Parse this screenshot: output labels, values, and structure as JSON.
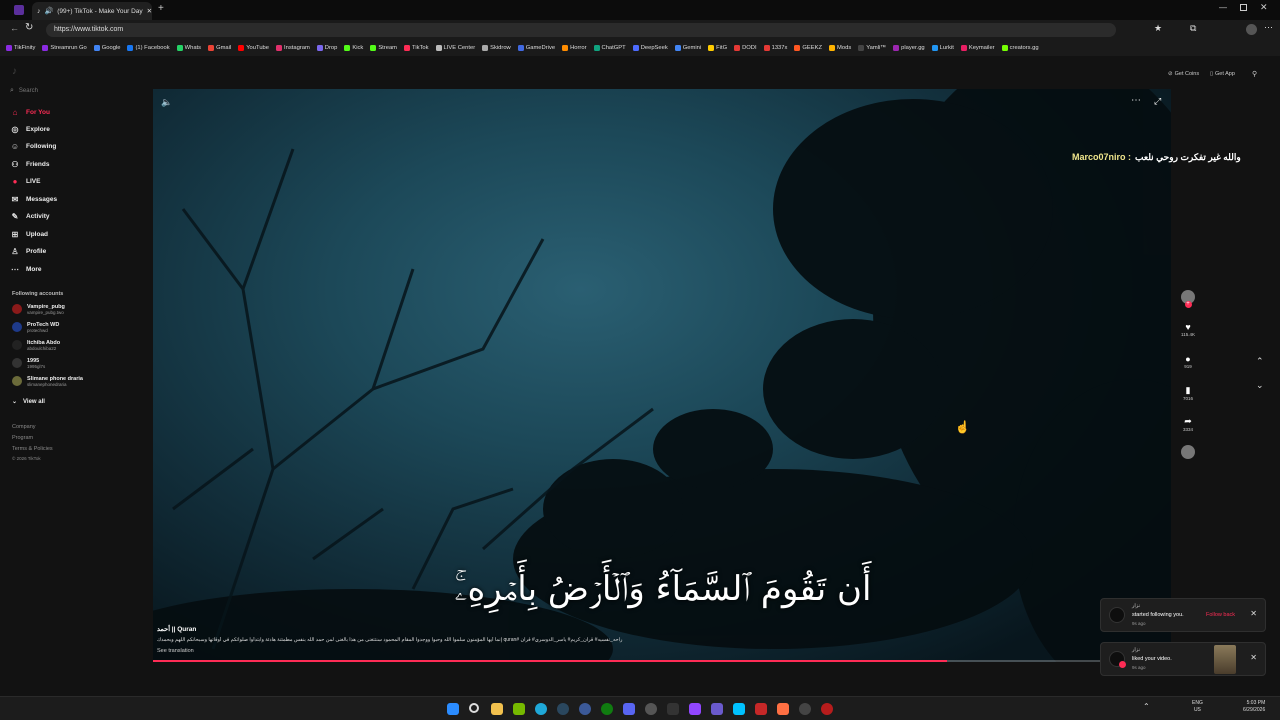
{
  "browser": {
    "tab_title": "(99+) TikTok - Make Your Day",
    "url": "https://www.tiktok.com",
    "bookmarks": [
      "TikFinity",
      "Streamrun Go",
      "Google",
      "(1) Facebook",
      "Whats",
      "Gmail",
      "YouTube",
      "Instagram",
      "Drop",
      "Kick",
      "Stream",
      "TikTok",
      "LIVE Center",
      "Skidrow",
      "GameDrive",
      "Horror",
      "ChatGPT",
      "DeepSeek",
      "Gemini",
      "FitG",
      "DODI",
      "1337x",
      "GEEKZ",
      "Mods",
      "Yamli™",
      "player.gg",
      "Lurkit",
      "Keymailer",
      "creators.gg"
    ],
    "bookmark_colors": [
      "#8a2be2",
      "#8a2be2",
      "#4285f4",
      "#1877f2",
      "#25d366",
      "#ea4335",
      "#ff0000",
      "#e1306c",
      "#7b68ee",
      "#53fc18",
      "#53fc18",
      "#fe2c55",
      "#bbbbbb",
      "#aaaaaa",
      "#4169e1",
      "#ff8c00",
      "#10a37f",
      "#4d6bfe",
      "#4285f4",
      "#ffcc00",
      "#e53935",
      "#e53935",
      "#ff5722",
      "#ffb300",
      "#444444",
      "#9c27b0",
      "#2196f3",
      "#e91e63",
      "#76ff03"
    ]
  },
  "sidebar": {
    "search_placeholder": "Search",
    "nav": [
      {
        "label": "For You",
        "icon": "home-icon",
        "active": true
      },
      {
        "label": "Explore",
        "icon": "compass-icon"
      },
      {
        "label": "Following",
        "icon": "following-icon"
      },
      {
        "label": "Friends",
        "icon": "friends-icon"
      },
      {
        "label": "LIVE",
        "icon": "live-icon"
      },
      {
        "label": "Messages",
        "icon": "messages-icon"
      },
      {
        "label": "Activity",
        "icon": "activity-icon"
      },
      {
        "label": "Upload",
        "icon": "upload-icon"
      },
      {
        "label": "Profile",
        "icon": "profile-icon"
      },
      {
        "label": "More",
        "icon": "more-icon"
      }
    ],
    "following_title": "Following accounts",
    "accounts": [
      {
        "name": "Vampire_pubg",
        "handle": "vampire_pubg.two"
      },
      {
        "name": "ProTech WD",
        "handle": "protechwd"
      },
      {
        "name": "Itchiba Abdo",
        "handle": "abdoulchiba22"
      },
      {
        "name": "1995",
        "handle": "1995gl7s"
      },
      {
        "name": "Slimane phone draria",
        "handle": "slimanephonedraria"
      }
    ],
    "view_all": "View all",
    "footer": [
      "Company",
      "Program",
      "Terms & Policies",
      "© 2026 TikTok"
    ]
  },
  "header_actions": {
    "coins": "Get Coins",
    "app": "Get App"
  },
  "video": {
    "comment_user": "Marco07niro :",
    "comment_text": "والله غير تفكرت روحي نلعب",
    "quran_text": "أَن تَقُومَ ٱلسَّمَآءُ وَٱلۡأَرۡضُ بِأَمۡرِهِۦۚ",
    "author": "أحمد || Quran",
    "description": "راحه_نفسيه# قرآن_كريم# ياسر_الدوسري# قرآن #quran إنما أيها المؤمنون سلموا الله وحبوا ووجدوا المقام المحمود سنتتغنى من هذا بالغنى لمن حمد الله بنفس مطمئنة هادئة وابتدأوا صلواتكم في أوقاتها وسبحانكم اللهم وبحمدك",
    "see_translation": "See translation",
    "progress": 0.78
  },
  "actions": {
    "likes": "115.4K",
    "comments": "919",
    "saves": "7016",
    "shares": "3334"
  },
  "notifications": [
    {
      "user": "نزار",
      "text": "started following you.",
      "ago": "9s ago",
      "action": "Follow back"
    },
    {
      "user": "نزار",
      "text": "liked your video.",
      "ago": "9s ago"
    }
  ],
  "taskbar": {
    "lang": "ENG",
    "region": "US",
    "time": "5:03 PM",
    "date": "6/29/2026"
  }
}
